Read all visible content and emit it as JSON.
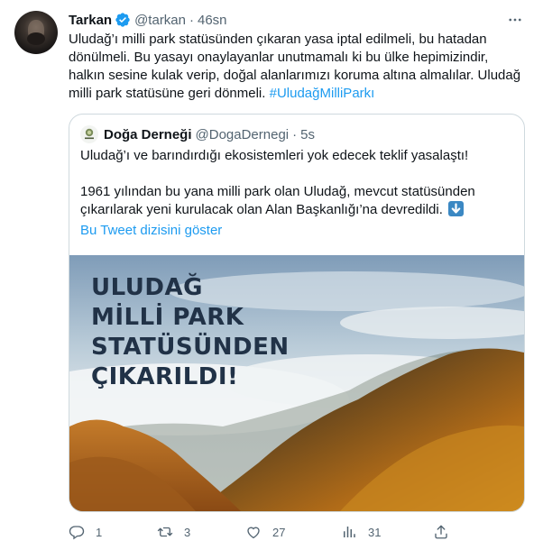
{
  "author": {
    "name": "Tarkan",
    "handle": "@tarkan",
    "separator": "·",
    "time": "46sn"
  },
  "tweet": {
    "lines": [
      "Uludağ’ı milli park statüsünden çıkaran yasa iptal edilmeli, bu hatadan",
      "dönülmeli. Bu yasayı onaylayanlar unutmamalı ki bu ülke hepimizindir,",
      "halkın sesine kulak verip, doğal alanlarımızı koruma altına almalılar. Uludağ",
      "milli park statüsüne geri dönmeli."
    ],
    "hashtag": "#UludağMilliParkı"
  },
  "quote": {
    "name": "Doğa Derneği",
    "handle": "@DogaDernegi",
    "separator": "·",
    "time": "5s",
    "line1": "Uludağ’ı ve barındırdığı ekosistemleri yok edecek teklif yasalaştı!",
    "line2": "1961 yılından bu yana milli park olan Uludağ, mevcut statüsünden",
    "line3": "çıkarılarak yeni kurulacak olan Alan Başkanlığı’na devredildi.",
    "show_thread": "Bu Tweet dizisini göster",
    "image_headline": [
      "ULUDAĞ",
      "MİLLİ PARK",
      "STATÜSÜNDEN",
      "ÇIKARILDI!"
    ]
  },
  "actions": {
    "reply_count": "1",
    "retweet_count": "3",
    "like_count": "27",
    "views_count": "31"
  },
  "colors": {
    "accent": "#1d9bf0",
    "text": "#0f1419",
    "secondary": "#536471",
    "border": "#cfd9de"
  },
  "icons": [
    "verified-badge-icon",
    "more-icon",
    "reply-icon",
    "retweet-icon",
    "like-icon",
    "views-icon",
    "share-icon",
    "down-arrow-emoji-icon"
  ]
}
